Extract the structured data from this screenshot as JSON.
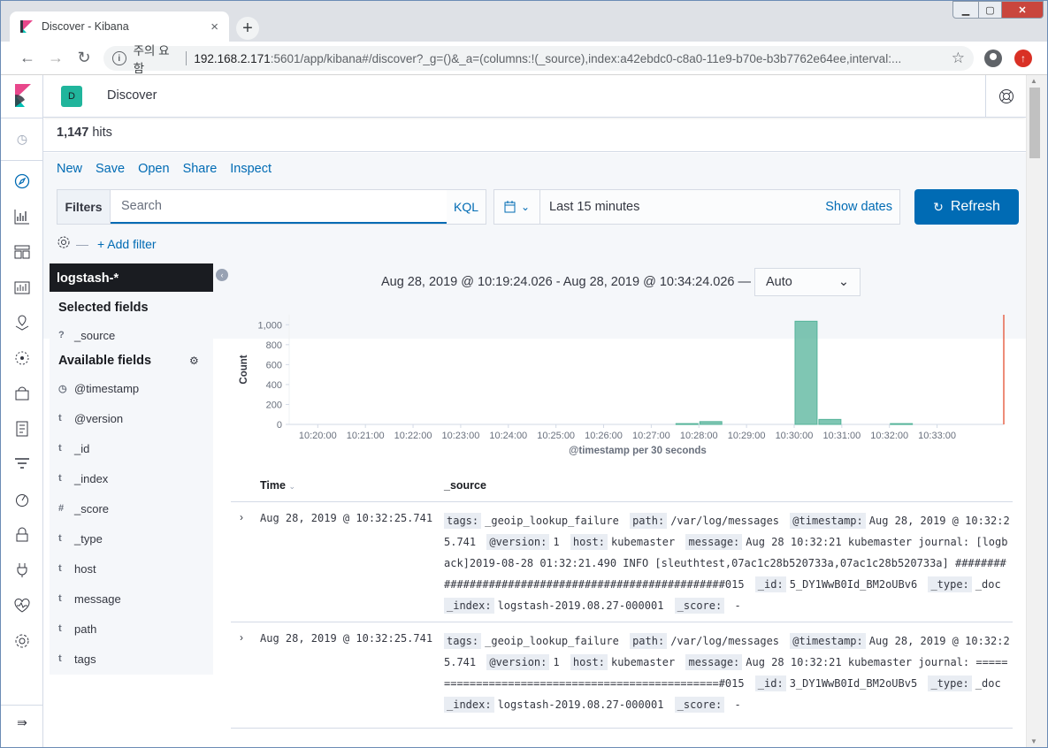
{
  "browser": {
    "tab_title": "Discover - Kibana",
    "tab_close": "×",
    "new_tab": "+",
    "security_label": "주의 요함",
    "url_host": "192.168.2.171",
    "url_path": ":5601/app/kibana#/discover?_g=()&_a=(columns:!(_source),index:a42ebdc0-c8a0-11e9-b70e-b3b7762e64ee,interval:..."
  },
  "header": {
    "space_initial": "D",
    "breadcrumb": "Discover"
  },
  "hits": {
    "count": "1,147",
    "label": "hits"
  },
  "menu": {
    "new": "New",
    "save": "Save",
    "open": "Open",
    "share": "Share",
    "inspect": "Inspect"
  },
  "query": {
    "filters_label": "Filters",
    "search_placeholder": "Search",
    "kql": "KQL",
    "time_range": "Last 15 minutes",
    "show_dates": "Show dates",
    "refresh": "Refresh",
    "add_filter": "+ Add filter"
  },
  "sidebar": {
    "index_pattern": "logstash-*",
    "selected_title": "Selected fields",
    "selected_fields": [
      {
        "type": "?",
        "name": "_source"
      }
    ],
    "available_title": "Available fields",
    "available_fields": [
      {
        "type": "◷",
        "name": "@timestamp"
      },
      {
        "type": "t",
        "name": "@version"
      },
      {
        "type": "t",
        "name": "_id"
      },
      {
        "type": "t",
        "name": "_index"
      },
      {
        "type": "#",
        "name": "_score"
      },
      {
        "type": "t",
        "name": "_type"
      },
      {
        "type": "t",
        "name": "host"
      },
      {
        "type": "t",
        "name": "message"
      },
      {
        "type": "t",
        "name": "path"
      },
      {
        "type": "t",
        "name": "tags"
      }
    ]
  },
  "histogram": {
    "range_text": "Aug 28, 2019 @ 10:19:24.026 - Aug 28, 2019 @ 10:34:24.026 —",
    "interval": "Auto",
    "color": "#54b399"
  },
  "chart_data": {
    "type": "bar",
    "ylabel": "Count",
    "xlabel": "@timestamp per 30 seconds",
    "ylim": [
      0,
      1100
    ],
    "yticks": [
      "0",
      "200",
      "400",
      "600",
      "800",
      "1,000"
    ],
    "categories": [
      "10:20:00",
      "10:21:00",
      "10:22:00",
      "10:23:00",
      "10:24:00",
      "10:25:00",
      "10:26:00",
      "10:27:00",
      "10:28:00",
      "10:29:00",
      "10:30:00",
      "10:31:00",
      "10:32:00",
      "10:33:00"
    ],
    "series": [
      {
        "points": [
          {
            "x": "10:27:30",
            "y": 8
          },
          {
            "x": "10:28:00",
            "y": 28
          },
          {
            "x": "10:30:00",
            "y": 1035
          },
          {
            "x": "10:30:30",
            "y": 50
          },
          {
            "x": "10:32:00",
            "y": 8
          }
        ]
      }
    ]
  },
  "table": {
    "time_header": "Time",
    "source_header": "_source",
    "rows": [
      {
        "time": "Aug 28, 2019 @ 10:32:25.741",
        "fields": [
          {
            "k": "tags:",
            "v": "_geoip_lookup_failure"
          },
          {
            "k": "path:",
            "v": "/var/log/messages"
          },
          {
            "k": "@timestamp:",
            "v": "Aug 28, 2019 @ 10:32:25.741"
          },
          {
            "k": "@version:",
            "v": "1"
          },
          {
            "k": "host:",
            "v": "kubemaster"
          },
          {
            "k": "message:",
            "v": "Aug 28 10:32:21 kubemaster journal: [logback]2019-08-28 01:32:21.490 INFO [sleuthtest,07ac1c28b520733a,07ac1c28b520733a] ####################################################015"
          },
          {
            "k": "_id:",
            "v": "5_DY1WwB0Id_BM2oUBv6"
          },
          {
            "k": "_type:",
            "v": "_doc"
          },
          {
            "k": "_index:",
            "v": "logstash-2019.08.27-000001"
          },
          {
            "k": "_score:",
            "v": " -"
          }
        ]
      },
      {
        "time": "Aug 28, 2019 @ 10:32:25.741",
        "fields": [
          {
            "k": "tags:",
            "v": "_geoip_lookup_failure"
          },
          {
            "k": "path:",
            "v": "/var/log/messages"
          },
          {
            "k": "@timestamp:",
            "v": "Aug 28, 2019 @ 10:32:25.741"
          },
          {
            "k": "@version:",
            "v": "1"
          },
          {
            "k": "host:",
            "v": "kubemaster"
          },
          {
            "k": "message:",
            "v": "Aug 28 10:32:21 kubemaster journal: ================================================#015"
          },
          {
            "k": "_id:",
            "v": "3_DY1WwB0Id_BM2oUBv5"
          },
          {
            "k": "_type:",
            "v": "_doc"
          },
          {
            "k": "_index:",
            "v": "logstash-2019.08.27-000001"
          },
          {
            "k": "_score:",
            "v": " -"
          }
        ]
      }
    ]
  }
}
